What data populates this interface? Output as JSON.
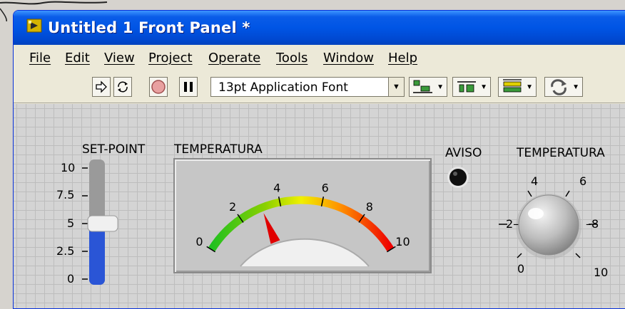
{
  "window": {
    "title": "Untitled 1 Front Panel *"
  },
  "menu": {
    "items": [
      {
        "label": "File"
      },
      {
        "label": "Edit"
      },
      {
        "label": "View"
      },
      {
        "label": "Project"
      },
      {
        "label": "Operate"
      },
      {
        "label": "Tools"
      },
      {
        "label": "Window"
      },
      {
        "label": "Help"
      }
    ]
  },
  "toolbar": {
    "font_value": "13pt Application Font",
    "icons": [
      "run-arrow-icon",
      "run-continuously-icon",
      "abort-icon",
      "pause-icon",
      "align-objects-icon",
      "distribute-objects-icon",
      "resize-objects-icon",
      "reorder-icon"
    ]
  },
  "panel": {
    "slider": {
      "label": "SET-POINT",
      "ticks": [
        "10",
        "7.5",
        "5",
        "2.5",
        "0"
      ],
      "value": 5,
      "range": [
        0,
        10
      ],
      "fill_color": "#2a55d6"
    },
    "gauge": {
      "label": "TEMPERATURA",
      "ticks": [
        "0",
        "2",
        "4",
        "6",
        "8",
        "10"
      ],
      "value": 3.1,
      "range": [
        0,
        10
      ],
      "needle_color": "#e00000"
    },
    "led": {
      "label": "AVISO",
      "state": "off",
      "color": "#101010"
    },
    "knob": {
      "label": "TEMPERATURA",
      "ticks": [
        "0",
        "2",
        "4",
        "6",
        "8",
        "10"
      ],
      "tick_display": [
        "0",
        "2–",
        "4",
        "6",
        "–8",
        "10"
      ]
    }
  }
}
